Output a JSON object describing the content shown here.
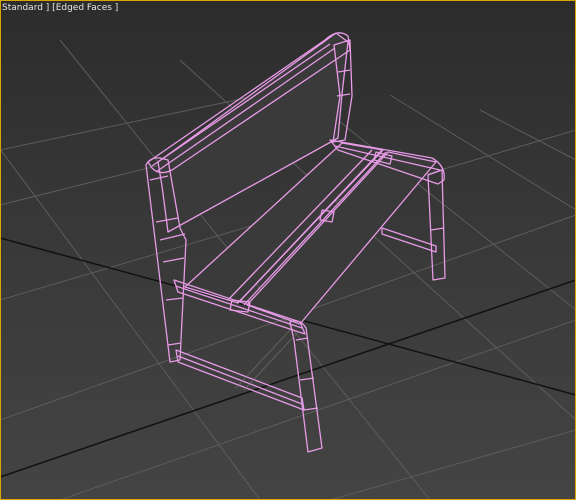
{
  "viewport": {
    "label_text": "Standard ] [Edged Faces ]",
    "colors": {
      "background_top": "#2c2c2c",
      "background_bottom": "#444444",
      "grid_line": "#5c5c5c",
      "grid_axis": "#111111",
      "active_border": "#d8a800",
      "wireframe": "#e79be6",
      "face_fill": "#3a3a3a"
    }
  },
  "scene": {
    "object": "bench",
    "display_mode": "edged-faces",
    "selected": true
  }
}
